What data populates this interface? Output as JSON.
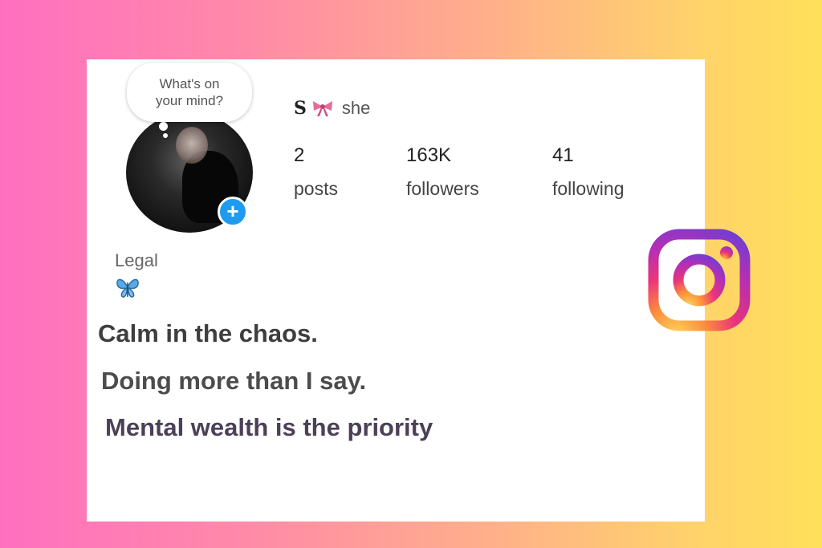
{
  "bubble": {
    "line1": "What's on",
    "line2": "your mind?"
  },
  "profile": {
    "name_initial": "S",
    "pronoun": "she"
  },
  "stats": [
    {
      "value": "2",
      "label": "posts"
    },
    {
      "value": "163K",
      "label": "followers"
    },
    {
      "value": "41",
      "label": "following"
    }
  ],
  "category": "Legal",
  "bio": {
    "line1": "Calm in the chaos.",
    "line2": "Doing more than I say.",
    "line3": "Mental wealth is the priority"
  },
  "icons": {
    "bow": "pink-bow-icon",
    "butterfly": "blue-butterfly-icon",
    "add": "plus-icon",
    "brand": "instagram-logo-icon"
  },
  "colors": {
    "add_button": "#1e9bf0",
    "gradient_left": "#ff6fc0",
    "gradient_right": "#ffe05a"
  }
}
